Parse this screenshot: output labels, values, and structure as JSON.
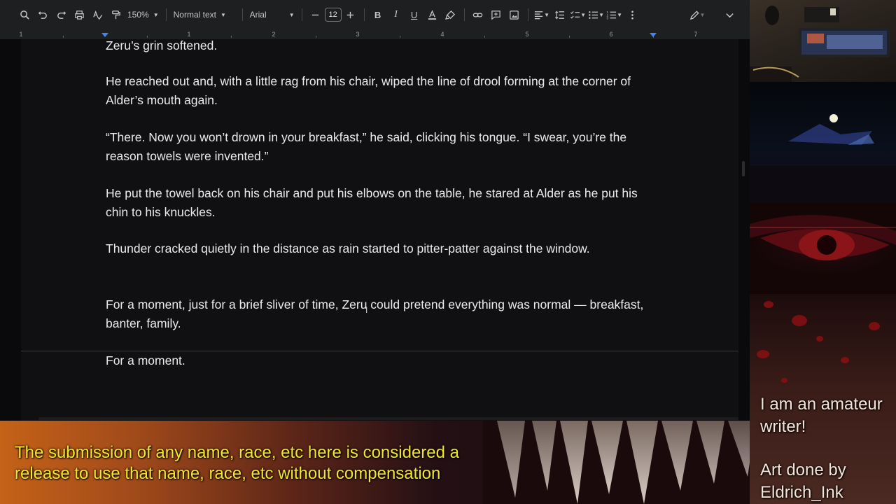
{
  "toolbar": {
    "zoom": "150%",
    "style": "Normal text",
    "font": "Arial",
    "font_size": "12"
  },
  "ruler": {
    "labels": [
      "1",
      "1",
      "2",
      "3",
      "4",
      "5",
      "6",
      "7"
    ]
  },
  "document": {
    "paragraphs": [
      "Zeru’s grin softened.",
      "He reached out and, with a little rag from his chair, wiped the line of drool forming at the corner of Alder’s mouth again.",
      "“There. Now you won’t drown in your breakfast,” he said, clicking his tongue. “I swear, you’re the reason towels were invented.”",
      "He put the towel back on his chair and put his elbows on the table, he stared at Alder as he put his chin to his knuckles.",
      "Thunder cracked quietly in the distance as rain started to pitter-patter against the window.",
      "For a moment, just for a brief sliver of time, Zeru could pretend everything was normal — breakfast, banter, family."
    ],
    "page2_paragraphs": [
      "For a moment."
    ]
  },
  "overlay": {
    "disclaimer": "The submission of any name, race, etc here is considered a release to use that name, race, etc without compensation",
    "writer_note": "I am an amateur writer!",
    "credit": "Art done by Eldrich_Ink"
  }
}
